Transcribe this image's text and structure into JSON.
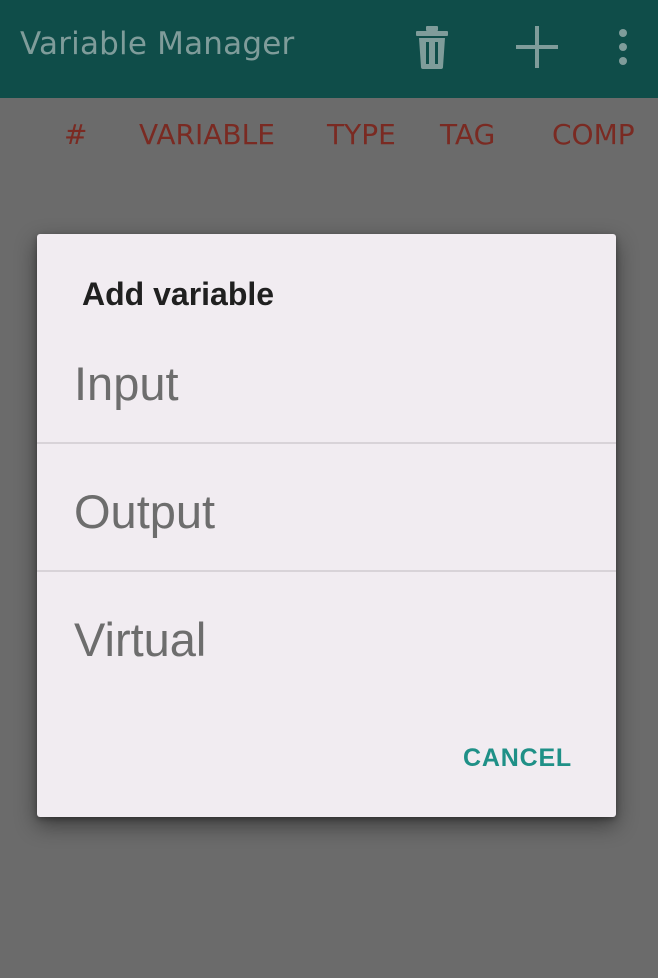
{
  "app_bar": {
    "title": "Variable Manager",
    "icons": [
      "trash-icon",
      "plus-icon",
      "more-vert-icon"
    ]
  },
  "table": {
    "columns": [
      "#",
      "VARIABLE",
      "TYPE",
      "TAG",
      "COMP"
    ]
  },
  "dialog": {
    "title": "Add variable",
    "options": [
      "Input",
      "Output",
      "Virtual"
    ],
    "cancel_label": "CANCEL"
  },
  "colors": {
    "app_bar": "#0f4d49",
    "column_header": "#7a2a22",
    "dialog_bg": "#f1ecf1",
    "accent": "#1f9087"
  }
}
